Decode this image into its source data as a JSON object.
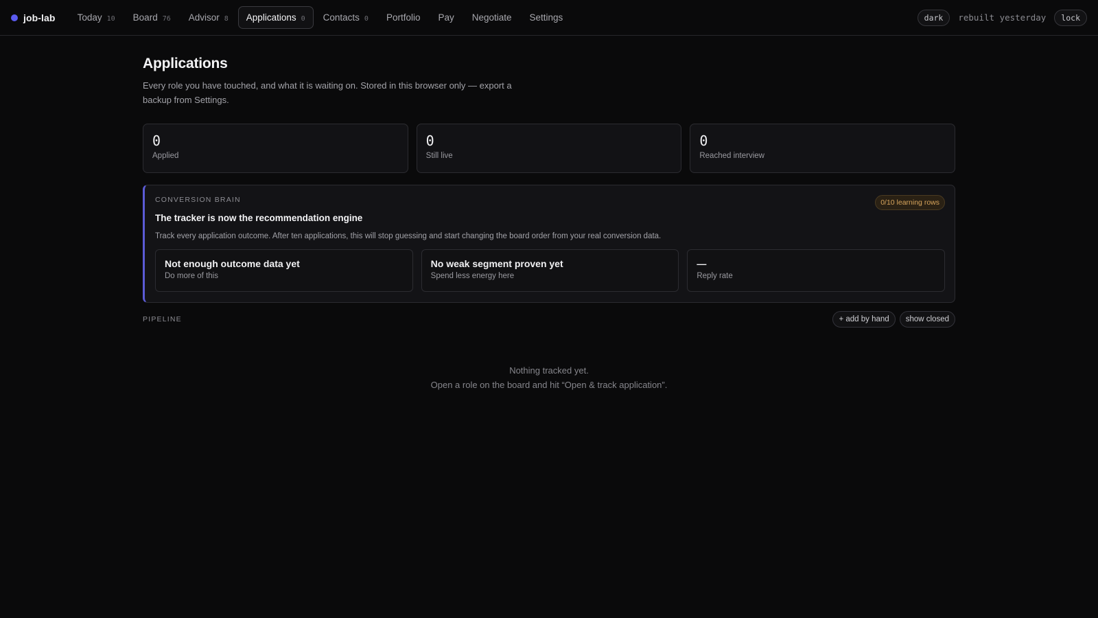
{
  "brand": {
    "name": "job-lab",
    "accent": "#5b5bf0"
  },
  "nav": [
    {
      "label": "Today",
      "count": "10"
    },
    {
      "label": "Board",
      "count": "76"
    },
    {
      "label": "Advisor",
      "count": "8"
    },
    {
      "label": "Applications",
      "count": "0",
      "active": true
    },
    {
      "label": "Contacts",
      "count": "0"
    },
    {
      "label": "Portfolio",
      "count": ""
    },
    {
      "label": "Pay",
      "count": ""
    },
    {
      "label": "Negotiate",
      "count": ""
    },
    {
      "label": "Settings",
      "count": ""
    }
  ],
  "topright": {
    "theme_label": "dark",
    "rebuilt": "rebuilt yesterday",
    "lock_label": "lock"
  },
  "page": {
    "title": "Applications",
    "subtitle": "Every role you have touched, and what it is waiting on. Stored in this browser only — export a backup from Settings."
  },
  "stats": [
    {
      "value": "0",
      "label": "Applied"
    },
    {
      "value": "0",
      "label": "Still live"
    },
    {
      "value": "0",
      "label": "Reached interview"
    }
  ],
  "brain": {
    "kicker": "CONVERSION BRAIN",
    "badge": "0/10 learning rows",
    "title": "The tracker is now the recommendation engine",
    "description": "Track every application outcome. After ten applications, this will stop guessing and start changing the board order from your real conversion data.",
    "cards": [
      {
        "title": "Not enough outcome data yet",
        "sub": "Do more of this"
      },
      {
        "title": "No weak segment proven yet",
        "sub": "Spend less energy here"
      },
      {
        "title": "—",
        "sub": "Reply rate"
      }
    ],
    "accent": "#5b5bd6",
    "badge_color": "#d8a55c"
  },
  "pipeline": {
    "label": "PIPELINE",
    "add_label": "+ add by hand",
    "closed_label": "show closed",
    "empty_line1": "Nothing tracked yet.",
    "empty_line2": "Open a role on the board and hit “Open & track application”."
  }
}
